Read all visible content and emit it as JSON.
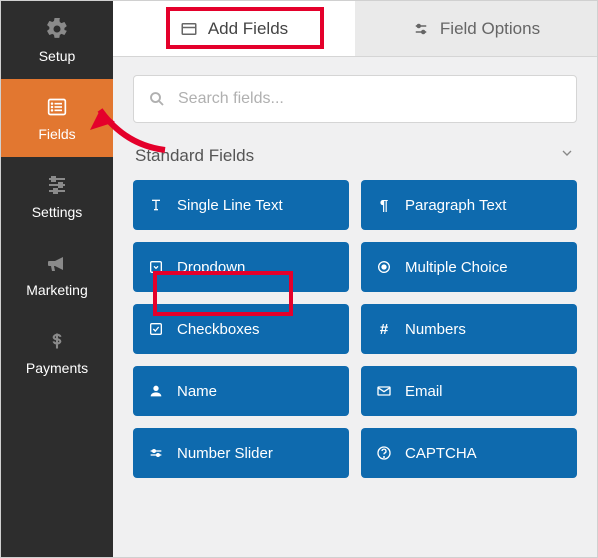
{
  "sidebar": {
    "items": [
      {
        "label": "Setup",
        "icon": "gear"
      },
      {
        "label": "Fields",
        "icon": "list",
        "active": true
      },
      {
        "label": "Settings",
        "icon": "sliders"
      },
      {
        "label": "Marketing",
        "icon": "bullhorn"
      },
      {
        "label": "Payments",
        "icon": "dollar"
      }
    ]
  },
  "tabs": {
    "add_fields": "Add Fields",
    "field_options": "Field Options"
  },
  "search": {
    "placeholder": "Search fields..."
  },
  "section": {
    "title": "Standard Fields"
  },
  "fields": [
    {
      "label": "Single Line Text",
      "icon": "text"
    },
    {
      "label": "Paragraph Text",
      "icon": "paragraph"
    },
    {
      "label": "Dropdown",
      "icon": "dropdown"
    },
    {
      "label": "Multiple Choice",
      "icon": "radio"
    },
    {
      "label": "Checkboxes",
      "icon": "checkbox"
    },
    {
      "label": "Numbers",
      "icon": "hash"
    },
    {
      "label": "Name",
      "icon": "person"
    },
    {
      "label": "Email",
      "icon": "envelope"
    },
    {
      "label": "Number Slider",
      "icon": "slider"
    },
    {
      "label": "CAPTCHA",
      "icon": "captcha"
    }
  ]
}
